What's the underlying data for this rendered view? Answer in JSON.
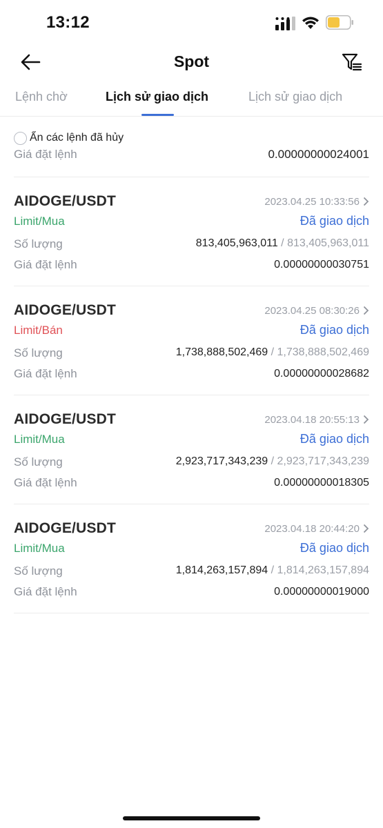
{
  "status_bar": {
    "time": "13:12",
    "battery_color": "#f5c542"
  },
  "header": {
    "title": "Spot",
    "back_icon": "arrow-left-icon",
    "filter_icon": "filter-icon"
  },
  "tabs": [
    {
      "label": "Lệnh chờ",
      "active": false
    },
    {
      "label": "Lịch sử giao dịch",
      "active": true
    },
    {
      "label": "Lịch sử giao dịch",
      "active": false
    }
  ],
  "filter": {
    "hide_cancelled_label": "Ẩn các lệnh đã hủy",
    "checked": false
  },
  "partial_row": {
    "label": "Giá đặt lệnh",
    "value": "0.00000000024001"
  },
  "orders": [
    {
      "pair": "AIDOGE/USDT",
      "datetime": "2023.04.25 10:33:56",
      "side": "Limit/Mua",
      "side_type": "buy",
      "status": "Đã giao dịch",
      "qty_label": "Số lượng",
      "qty_filled": "813,405,963,011",
      "qty_separator": " / ",
      "qty_total": "813,405,963,011",
      "price_label": "Giá đặt lệnh",
      "price": "0.00000000030751"
    },
    {
      "pair": "AIDOGE/USDT",
      "datetime": "2023.04.25 08:30:26",
      "side": "Limit/Bán",
      "side_type": "sell",
      "status": "Đã giao dịch",
      "qty_label": "Số lượng",
      "qty_filled": "1,738,888,502,469",
      "qty_separator": " / ",
      "qty_total": "1,738,888,502,469",
      "price_label": "Giá đặt lệnh",
      "price": "0.00000000028682"
    },
    {
      "pair": "AIDOGE/USDT",
      "datetime": "2023.04.18 20:55:13",
      "side": "Limit/Mua",
      "side_type": "buy",
      "status": "Đã giao dịch",
      "qty_label": "Số lượng",
      "qty_filled": "2,923,717,343,239",
      "qty_separator": " / ",
      "qty_total": "2,923,717,343,239",
      "price_label": "Giá đặt lệnh",
      "price": "0.00000000018305"
    },
    {
      "pair": "AIDOGE/USDT",
      "datetime": "2023.04.18 20:44:20",
      "side": "Limit/Mua",
      "side_type": "buy",
      "status": "Đã giao dịch",
      "qty_label": "Số lượng",
      "qty_filled": "1,814,263,157,894",
      "qty_separator": " / ",
      "qty_total": "1,814,263,157,894",
      "price_label": "Giá đặt lệnh",
      "price": "0.00000000019000"
    }
  ],
  "colors": {
    "accent": "#3d6fd6",
    "buy": "#3ba56c",
    "sell": "#e05257"
  }
}
